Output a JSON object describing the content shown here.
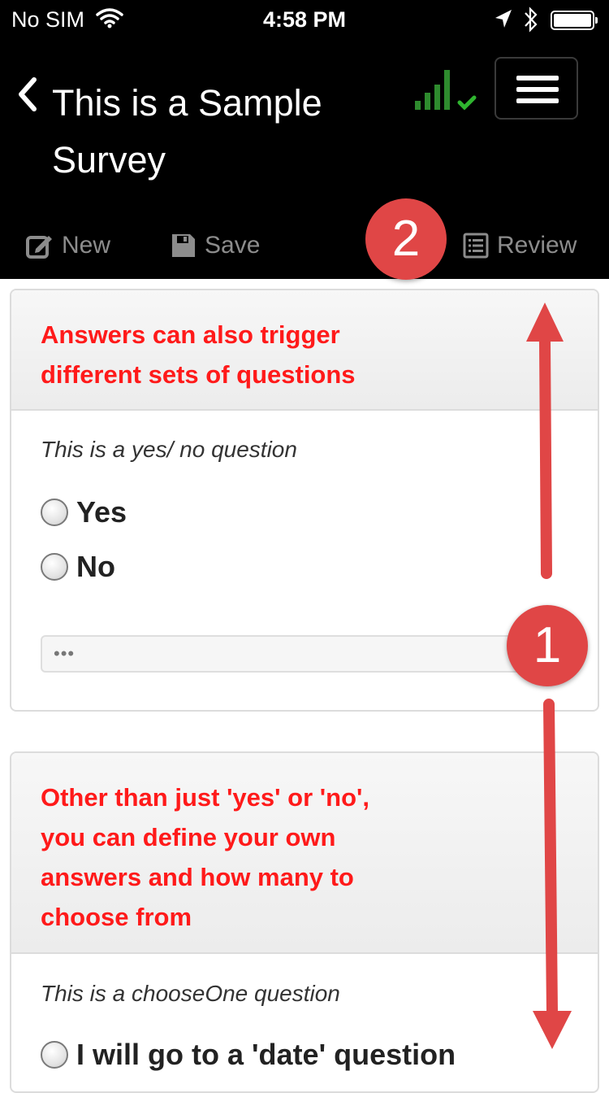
{
  "status_bar": {
    "carrier": "No SIM",
    "time": "4:58 PM"
  },
  "header": {
    "title_line1": "This is a Sample",
    "title_line2": "Survey",
    "signal_color": "#2e8b2e"
  },
  "toolbar": {
    "new_label": "New",
    "save_label": "Save",
    "review_label": "Review"
  },
  "annotations": {
    "badge_top": "2",
    "badge_side": "1",
    "color": "#e04646"
  },
  "panels": [
    {
      "heading_line1": "Answers can also trigger",
      "heading_line2": "different sets of questions",
      "question": "This is a yes/ no question",
      "options": [
        "Yes",
        "No"
      ],
      "comment_placeholder": "•••"
    },
    {
      "heading_line1": "Other than just 'yes' or 'no',",
      "heading_line2": "you can define your own",
      "heading_line3": "answers and how many to",
      "heading_line4": "choose from",
      "question": "This is a chooseOne question",
      "options": [
        "I will go to a 'date' question"
      ]
    }
  ]
}
